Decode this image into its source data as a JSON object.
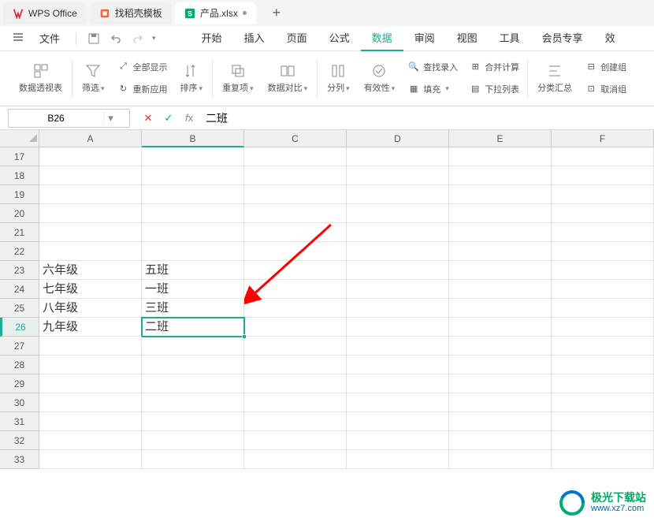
{
  "tabs": {
    "wps": "WPS Office",
    "docer": "找稻壳模板",
    "file": "产品.xlsx"
  },
  "menu": {
    "file_label": "文件",
    "tabs": [
      "开始",
      "插入",
      "页面",
      "公式",
      "数据",
      "审阅",
      "视图",
      "工具",
      "会员专享",
      "效"
    ]
  },
  "toolbar": {
    "pivot": "数据透视表",
    "filter": "筛选",
    "show_all": "全部显示",
    "reapply": "重新应用",
    "sort": "排序",
    "duplicate": "重复项",
    "compare": "数据对比",
    "split_col": "分列",
    "validity": "有效性",
    "find_entry": "查找录入",
    "fill": "填充",
    "consolidate": "合并计算",
    "dropdown": "下拉列表",
    "subtotal": "分类汇总",
    "create_group": "创建组",
    "ungroup": "取消组"
  },
  "formula": {
    "cell_ref": "B26",
    "value": "二班"
  },
  "grid": {
    "columns": [
      "A",
      "B",
      "C",
      "D",
      "E",
      "F"
    ],
    "row_start": 17,
    "row_end": 33,
    "active_row": 26,
    "active_col": "B",
    "data": {
      "23": {
        "A": "六年级",
        "B": "五班"
      },
      "24": {
        "A": "七年级",
        "B": "一班"
      },
      "25": {
        "A": "八年级",
        "B": "三班"
      },
      "26": {
        "A": "九年级",
        "B": "二班"
      }
    }
  },
  "watermark": {
    "title": "极光下载站",
    "url": "www.xz7.com"
  }
}
